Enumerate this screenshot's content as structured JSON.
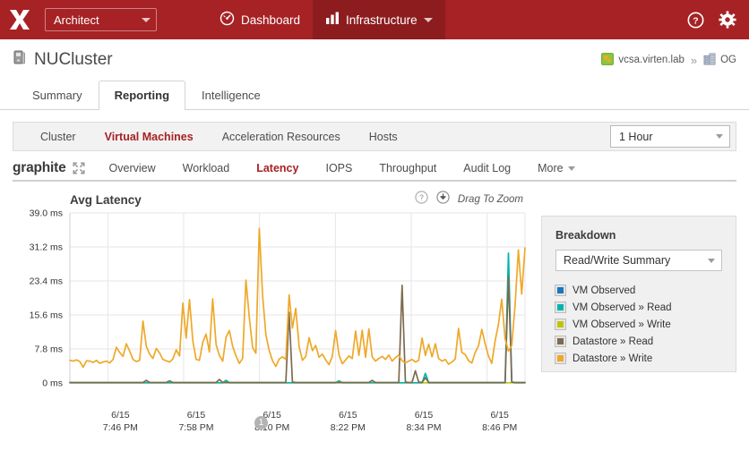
{
  "topbar": {
    "logo_name": "x-logo",
    "role_select": "Architect",
    "nav": [
      {
        "label": "Dashboard",
        "icon": "speedometer-icon",
        "active": false,
        "caret": false
      },
      {
        "label": "Infrastructure",
        "icon": "bar-chart-icon",
        "active": true,
        "caret": true
      }
    ],
    "help_icon": "help-circle-icon",
    "settings_icon": "gear-icon",
    "bg_color": "#a62225",
    "active_bg_color": "#8d1c1f"
  },
  "pagehead": {
    "title": "NUCluster",
    "title_icon": "cluster-icon",
    "breadcrumb": [
      {
        "label": "vcsa.virten.lab",
        "icon": "vcenter-icon"
      },
      {
        "label": "OG",
        "icon": "building-icon"
      }
    ],
    "separator": "»"
  },
  "tabs": [
    {
      "label": "Summary",
      "active": false
    },
    {
      "label": "Reporting",
      "active": true
    },
    {
      "label": "Intelligence",
      "active": false
    }
  ],
  "subnav": {
    "items": [
      {
        "label": "Cluster",
        "active": false
      },
      {
        "label": "Virtual Machines",
        "active": true
      },
      {
        "label": "Acceleration Resources",
        "active": false
      },
      {
        "label": "Hosts",
        "active": false
      }
    ],
    "range_value": "1 Hour"
  },
  "graphite_bar": {
    "brand": "graphite",
    "expand_icon": "expand-arrows-icon",
    "items": [
      {
        "label": "Overview",
        "active": false
      },
      {
        "label": "Workload",
        "active": false
      },
      {
        "label": "Latency",
        "active": true
      },
      {
        "label": "IOPS",
        "active": false
      },
      {
        "label": "Throughput",
        "active": false
      },
      {
        "label": "Audit Log",
        "active": false
      }
    ],
    "more_label": "More",
    "accent_color": "#a62225"
  },
  "chart_panel": {
    "title": "Avg Latency",
    "help_icon": "help-circle-icon",
    "download_icon": "download-circle-icon",
    "drag_hint": "Drag To Zoom",
    "marker_badge": "1"
  },
  "breakdown": {
    "title": "Breakdown",
    "select_value": "Read/Write Summary",
    "legend": [
      {
        "label": "VM Observed",
        "color": "#1b75bb"
      },
      {
        "label": "VM Observed » Read",
        "color": "#00b5ad"
      },
      {
        "label": "VM Observed » Write",
        "color": "#c3c400"
      },
      {
        "label": "Datastore » Read",
        "color": "#7d6a4f"
      },
      {
        "label": "Datastore » Write",
        "color": "#efa829"
      }
    ]
  },
  "chart_data": {
    "type": "line",
    "title": "Avg Latency",
    "xlabel": "",
    "ylabel": "",
    "unit": "ms",
    "ylim": [
      0,
      39.0
    ],
    "yticks": [
      0,
      7.8,
      15.6,
      23.4,
      31.2,
      39.0
    ],
    "ytick_labels": [
      "0 ms",
      "7.8 ms",
      "15.6 ms",
      "23.4 ms",
      "31.2 ms",
      "39.0 ms"
    ],
    "grid": true,
    "legend_position": "right-panel",
    "xtick_labels": [
      "6/15\n7:46 PM",
      "6/15\n7:58 PM",
      "6/15\n8:10 PM",
      "6/15\n8:22 PM",
      "6/15\n8:34 PM",
      "6/15\n8:46 PM"
    ],
    "xtick_dates": [
      "6/15",
      "6/15",
      "6/15",
      "6/15",
      "6/15",
      "6/15"
    ],
    "xtick_times": [
      "7:46 PM",
      "7:58 PM",
      "8:10 PM",
      "8:22 PM",
      "8:34 PM",
      "8:46 PM"
    ],
    "x_range": [
      "7:44 PM",
      "8:50 PM"
    ],
    "series": [
      {
        "name": "Datastore » Write",
        "color": "#efa829",
        "values": [
          5.2,
          5.0,
          5.3,
          4.9,
          3.6,
          5.1,
          5.0,
          4.7,
          5.2,
          4.5,
          4.8,
          5.0,
          4.6,
          5.4,
          8.2,
          7.0,
          6.1,
          9.0,
          7.3,
          5.4,
          4.9,
          5.2,
          14.2,
          8.4,
          6.6,
          5.6,
          7.9,
          6.9,
          5.4,
          5.1,
          4.8,
          5.5,
          7.6,
          6.2,
          18.3,
          10.3,
          19.1,
          9.7,
          5.4,
          5.2,
          9.3,
          11.2,
          7.1,
          19.3,
          8.8,
          6.3,
          5.0,
          10.5,
          12.0,
          8.4,
          6.2,
          4.5,
          5.6,
          23.6,
          15.2,
          8.2,
          6.8,
          35.5,
          20.1,
          11.0,
          7.4,
          5.1,
          3.8,
          5.5,
          6.0,
          5.4,
          20.2,
          12.6,
          17.1,
          8.3,
          5.2,
          6.1,
          10.4,
          7.4,
          8.6,
          5.9,
          6.6,
          5.3,
          4.2,
          6.1,
          12.0,
          6.4,
          4.4,
          5.3,
          6.2,
          5.6,
          11.9,
          6.3,
          12.1,
          5.9,
          12.4,
          6.0,
          5.0,
          5.6,
          6.1,
          5.4,
          6.4,
          5.0,
          5.8,
          6.4,
          5.1,
          4.6,
          5.0,
          5.4,
          4.8,
          5.2,
          10.3,
          6.3,
          8.9,
          6.0,
          9.0,
          5.6,
          5.0,
          5.4,
          4.3,
          4.8,
          5.5,
          12.5,
          7.0,
          6.5,
          5.1,
          4.6,
          7.0,
          8.5,
          12.3,
          9.0,
          6.2,
          4.5,
          9.6,
          13.4,
          19.2,
          10.1,
          7.3,
          8.6,
          17.8,
          30.5,
          20.4,
          31.0
        ]
      },
      {
        "name": "Datastore » Read",
        "color": "#7d6a4f",
        "values": [
          0.1,
          0.1,
          0.1,
          0.1,
          0.1,
          0.1,
          0.1,
          0.1,
          0.1,
          0.1,
          0.1,
          0.1,
          0.1,
          0.1,
          0.1,
          0.1,
          0.1,
          0.1,
          0.1,
          0.1,
          0.1,
          0.1,
          0.1,
          0.6,
          0.1,
          0.1,
          0.1,
          0.1,
          0.1,
          0.1,
          0.5,
          0.1,
          0.1,
          0.1,
          0.1,
          0.1,
          0.1,
          0.1,
          0.1,
          0.1,
          0.1,
          0.1,
          0.1,
          0.1,
          0.1,
          0.8,
          0.1,
          0.1,
          0.1,
          0.1,
          0.1,
          0.1,
          0.1,
          0.1,
          0.1,
          0.1,
          0.1,
          0.1,
          0.1,
          0.1,
          0.1,
          0.1,
          0.1,
          0.1,
          0.1,
          0.1,
          16.2,
          0.2,
          0.1,
          0.1,
          0.1,
          0.1,
          0.1,
          0.1,
          0.1,
          0.1,
          0.1,
          0.1,
          0.1,
          0.1,
          0.1,
          0.1,
          0.1,
          0.1,
          0.1,
          0.1,
          0.1,
          0.1,
          0.1,
          0.1,
          0.1,
          0.6,
          0.1,
          0.1,
          0.1,
          0.1,
          0.1,
          0.1,
          0.1,
          0.1,
          22.4,
          0.2,
          0.1,
          0.1,
          2.8,
          0.2,
          0.1,
          1.2,
          0.1,
          0.1,
          0.1,
          0.1,
          0.1,
          0.1,
          0.1,
          0.1,
          0.1,
          0.1,
          0.1,
          0.1,
          0.1,
          0.1,
          0.1,
          0.1,
          0.1,
          0.1,
          0.1,
          0.1,
          0.1,
          0.1,
          0.1,
          0.1,
          24.5,
          0.2,
          0.1,
          0.1,
          0.1,
          0.1
        ]
      },
      {
        "name": "VM Observed » Write",
        "color": "#c3c400",
        "values": [
          0.05,
          0.05,
          0.05,
          0.05,
          0.05,
          0.05,
          0.05,
          0.05,
          0.05,
          0.05,
          0.05,
          0.05,
          0.05,
          0.05,
          0.05,
          0.05,
          0.05,
          0.05,
          0.05,
          0.05,
          0.05,
          0.05,
          0.05,
          0.05,
          0.05,
          0.05,
          0.05,
          0.05,
          0.05,
          0.05,
          0.05,
          0.05,
          0.05,
          0.05,
          0.05,
          0.05,
          0.05,
          0.05,
          0.05,
          0.05,
          0.05,
          0.05,
          0.05,
          0.05,
          0.05,
          0.05,
          0.05,
          0.05,
          0.05,
          0.05,
          0.05,
          0.05,
          0.05,
          0.05,
          0.05,
          0.05,
          0.05,
          0.05,
          0.05,
          0.05,
          0.05,
          0.05,
          0.05,
          0.05,
          0.05,
          0.05,
          0.05,
          0.05,
          0.05,
          0.05,
          0.05,
          0.05,
          0.05,
          0.05,
          0.05,
          0.05,
          0.05,
          0.05,
          0.05,
          0.05,
          0.05,
          0.05,
          0.05,
          0.05,
          0.05,
          0.05,
          0.05,
          0.05,
          0.05,
          0.05,
          0.05,
          0.05,
          0.05,
          0.05,
          0.05,
          0.05,
          0.05,
          0.05,
          0.05,
          0.05,
          0.05,
          0.05,
          0.05,
          0.05,
          0.05,
          0.05,
          0.05,
          0.05,
          0.05,
          0.05,
          0.05,
          0.05,
          0.05,
          0.05,
          0.05,
          0.05,
          0.05,
          0.05,
          0.05,
          0.05,
          0.05,
          0.05,
          0.05,
          0.05,
          0.05,
          0.05,
          0.05,
          0.05,
          0.05,
          0.05,
          0.05,
          0.05,
          0.05,
          0.05,
          0.05,
          0.05,
          0.05,
          0.05
        ]
      },
      {
        "name": "VM Observed » Read",
        "color": "#00b5ad",
        "values": [
          0.05,
          0.05,
          0.05,
          0.05,
          0.05,
          0.05,
          0.05,
          0.05,
          0.05,
          0.05,
          0.05,
          0.05,
          0.05,
          0.05,
          0.05,
          0.05,
          0.05,
          0.05,
          0.05,
          0.05,
          0.05,
          0.05,
          0.05,
          0.05,
          0.05,
          0.05,
          0.05,
          0.05,
          0.05,
          0.05,
          0.05,
          0.05,
          0.05,
          0.05,
          0.05,
          0.05,
          0.05,
          0.05,
          0.05,
          0.05,
          0.05,
          0.05,
          0.05,
          0.05,
          0.05,
          0.05,
          0.05,
          0.6,
          0.05,
          0.05,
          0.05,
          0.05,
          0.05,
          0.05,
          0.05,
          0.05,
          0.05,
          0.05,
          0.05,
          0.05,
          0.05,
          0.05,
          0.05,
          0.05,
          0.05,
          0.05,
          0.05,
          0.05,
          0.05,
          0.05,
          0.05,
          0.05,
          0.05,
          0.05,
          0.05,
          0.05,
          0.05,
          0.05,
          0.05,
          0.05,
          0.05,
          0.5,
          0.05,
          0.05,
          0.05,
          0.05,
          0.05,
          0.05,
          0.05,
          0.05,
          0.05,
          0.05,
          0.05,
          0.05,
          0.05,
          0.05,
          0.05,
          0.05,
          0.05,
          0.05,
          0.05,
          0.05,
          0.05,
          0.05,
          0.05,
          0.05,
          0.05,
          2.2,
          0.05,
          0.05,
          0.05,
          0.05,
          0.05,
          0.05,
          0.05,
          0.05,
          0.05,
          0.05,
          0.05,
          0.05,
          0.05,
          0.05,
          0.05,
          0.05,
          0.05,
          0.05,
          0.05,
          0.05,
          0.05,
          0.05,
          0.05,
          0.05,
          29.8,
          0.2,
          0.05,
          0.05,
          0.05,
          0.05
        ]
      },
      {
        "name": "VM Observed",
        "color": "#1b75bb",
        "values": []
      }
    ]
  }
}
